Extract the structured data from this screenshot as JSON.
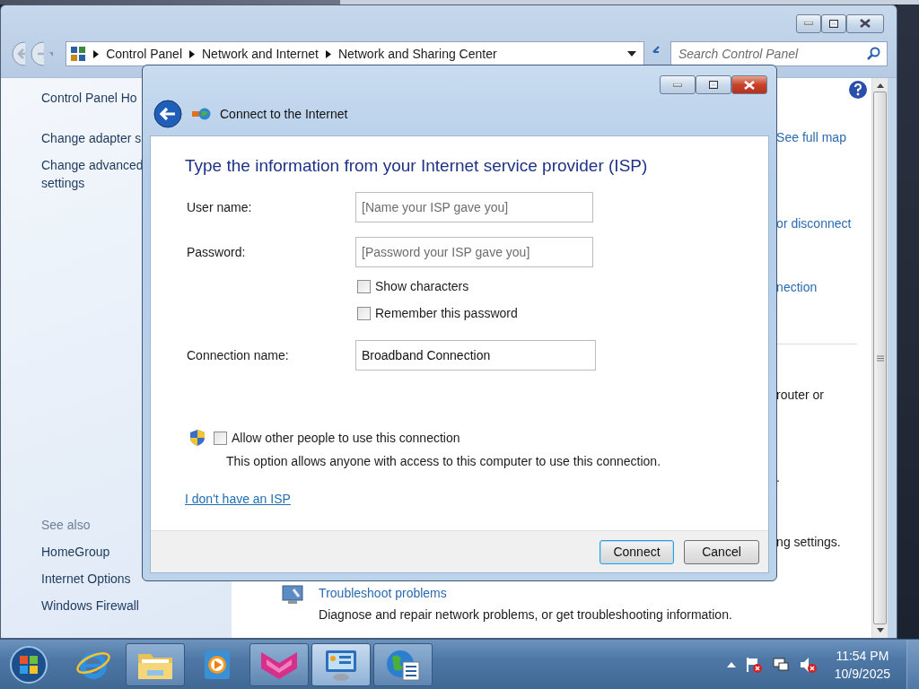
{
  "explorer": {
    "breadcrumb": [
      "Control Panel",
      "Network and Internet",
      "Network and Sharing Center"
    ],
    "search": {
      "placeholder": "Search Control Panel"
    },
    "sidebar": {
      "links": [
        "Control Panel Ho",
        "Change adapter s",
        "Change advanced\nsettings"
      ],
      "see_also_title": "See also",
      "see_also": [
        "HomeGroup",
        "Internet Options",
        "Windows Firewall"
      ]
    },
    "fragments": [
      {
        "kind": "link",
        "text": "See full map"
      },
      {
        "kind": "link",
        "text": "or disconnect"
      },
      {
        "kind": "link",
        "text": "nection"
      },
      {
        "kind": "divider"
      },
      {
        "kind": "text",
        "text": "router or"
      },
      {
        "kind": "text",
        "text": "."
      },
      {
        "kind": "text",
        "text": "ng settings."
      }
    ],
    "troubleshoot": {
      "title": "Troubleshoot problems",
      "description": "Diagnose and repair network problems, or get troubleshooting information."
    }
  },
  "dialog": {
    "title": "Connect to the Internet",
    "heading": "Type the information from your Internet service provider (ISP)",
    "items": [
      {
        "kind": "field",
        "label": "User name:",
        "placeholder": "[Name your ISP gave you]"
      },
      {
        "kind": "field",
        "label": "Password:",
        "placeholder": "[Password your ISP gave you]"
      },
      {
        "kind": "checkbox",
        "label": "Show characters",
        "checked": false
      },
      {
        "kind": "checkbox",
        "label": "Remember this password",
        "checked": false
      },
      {
        "kind": "field",
        "label": "Connection name:",
        "value": "Broadband Connection"
      }
    ],
    "allow": {
      "label": "Allow other people to use this connection",
      "checked": false,
      "note": "This option allows anyone with access to this computer to use this connection."
    },
    "link": "I don't have an ISP",
    "buttons": [
      {
        "label": "Connect",
        "default": true
      },
      {
        "label": "Cancel",
        "default": false
      }
    ]
  },
  "taskbar": {
    "apps": [
      {
        "kind": "ie",
        "running": false,
        "selected": false
      },
      {
        "kind": "folder",
        "running": true,
        "selected": false
      },
      {
        "kind": "media",
        "running": false,
        "selected": false
      },
      {
        "kind": "pink",
        "running": true,
        "selected": false
      },
      {
        "kind": "panel",
        "running": true,
        "selected": true
      },
      {
        "kind": "globe",
        "running": true,
        "selected": false
      }
    ],
    "time": "11:54 PM",
    "date": "10/9/2025"
  }
}
